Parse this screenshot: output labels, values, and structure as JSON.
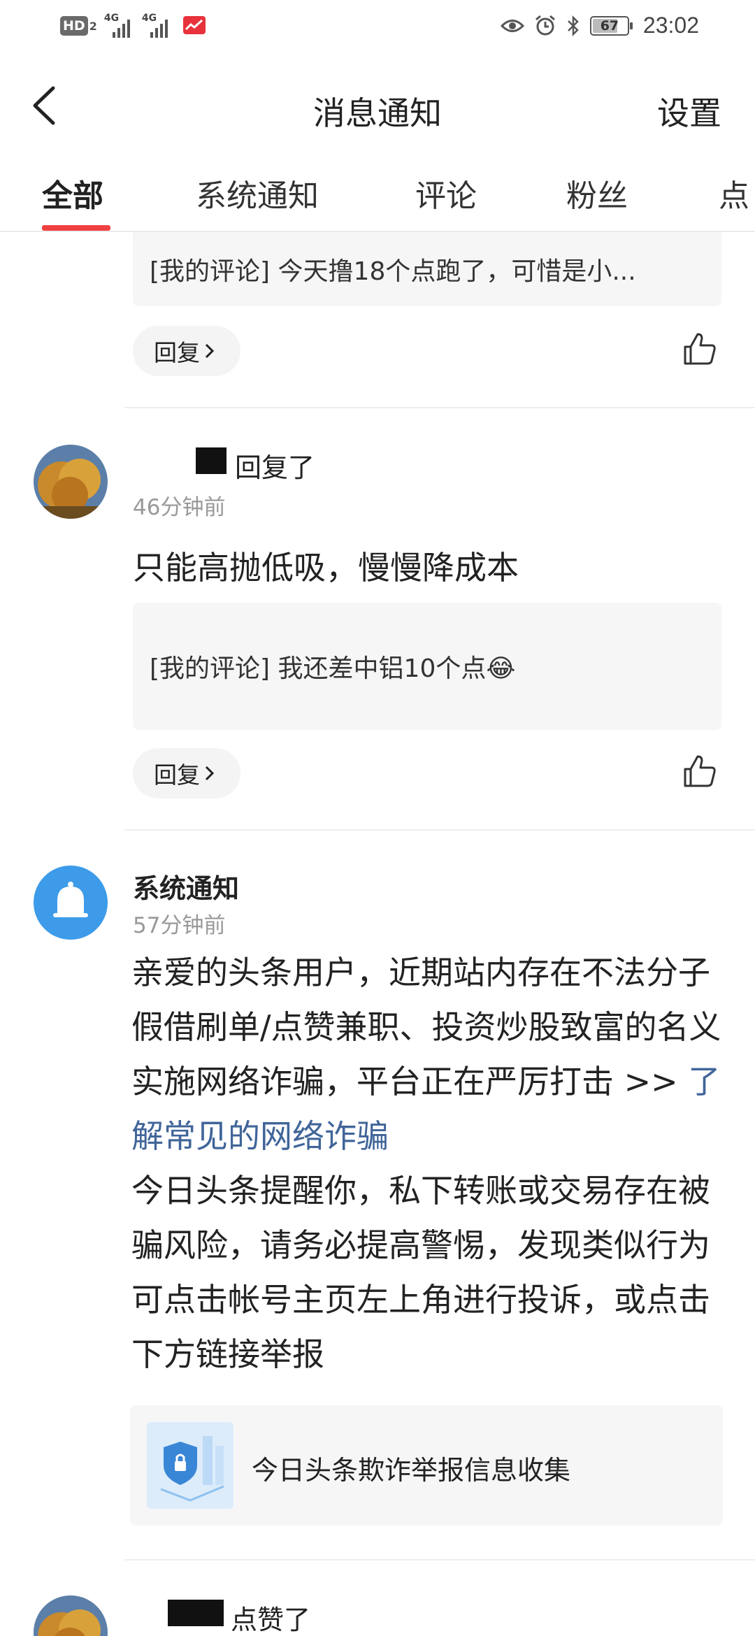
{
  "status_bar": {
    "hd_label": "HD",
    "hd_sub": "2",
    "network_1": "4G",
    "network_2": "4G",
    "battery": "67",
    "time": "23:02"
  },
  "header": {
    "title": "消息通知",
    "settings_label": "设置"
  },
  "tabs": [
    {
      "label": "全部",
      "active": true
    },
    {
      "label": "系统通知",
      "active": false
    },
    {
      "label": "评论",
      "active": false
    },
    {
      "label": "粉丝",
      "active": false
    },
    {
      "label": "点",
      "active": false
    }
  ],
  "feed": {
    "item1": {
      "quote": "[我的评论] 今天撸18个点跑了，可惜是小...",
      "reply_label": "回复"
    },
    "item2": {
      "action": "回复了",
      "time": "46分钟前",
      "text": "只能高抛低吸，慢慢降成本",
      "quote": "[我的评论] 我还差中铝10个点😂",
      "reply_label": "回复"
    },
    "item3": {
      "name": "系统通知",
      "time": "57分钟前",
      "body_part1": "亲爱的头条用户，近期站内存在不法分子假借刷单/点赞兼职、投资炒股致富的名义实施网络诈骗，平台正在严厉打击 >> ",
      "link_text": "了解常见的网络诈骗",
      "body_part2": "今日头条提醒你，私下转账或交易存在被骗风险，请务必提高警惕，发现类似行为可点击帐号主页左上角进行投诉，或点击下方链接举报",
      "card_text": "今日头条欺诈举报信息收集"
    },
    "item4": {
      "action": "点赞了"
    }
  },
  "colors": {
    "accent": "#f04142",
    "link": "#406599",
    "bell_bg": "#3d9be9"
  }
}
